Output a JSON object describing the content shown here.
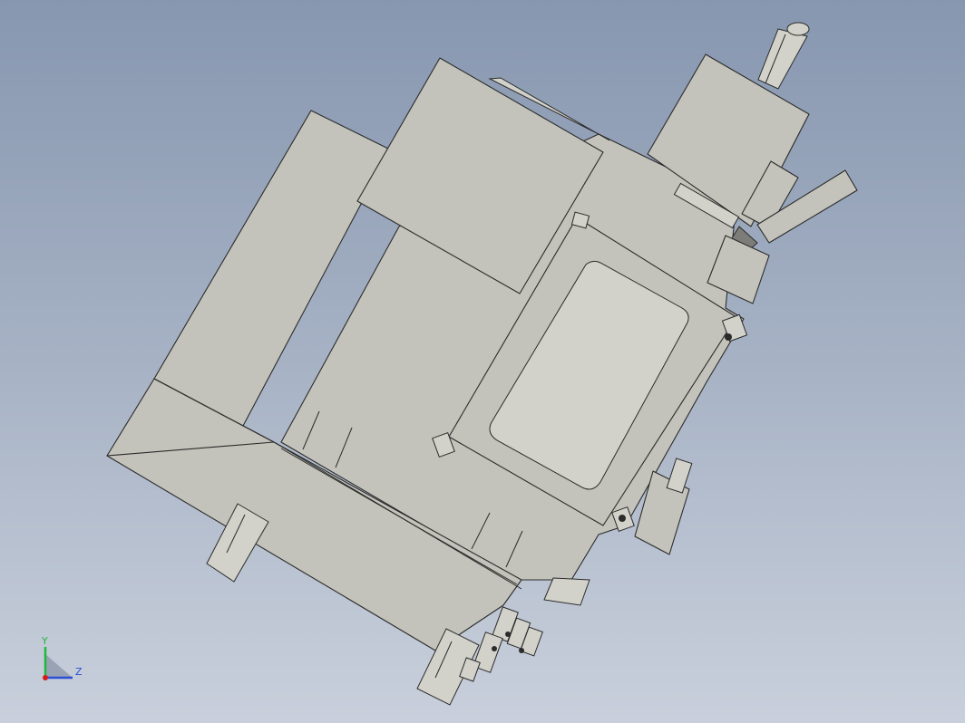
{
  "viewport": {
    "background_top": "#8797b0",
    "background_bottom": "#c9d0dc",
    "part_color": "#c3c3bb",
    "edge_color": "#2b2b2b"
  },
  "triad": {
    "y_label": "Y",
    "z_label": "Z",
    "y_color": "#1fb83a",
    "z_color": "#2c4fd6",
    "x_color": "#d61c1c"
  }
}
